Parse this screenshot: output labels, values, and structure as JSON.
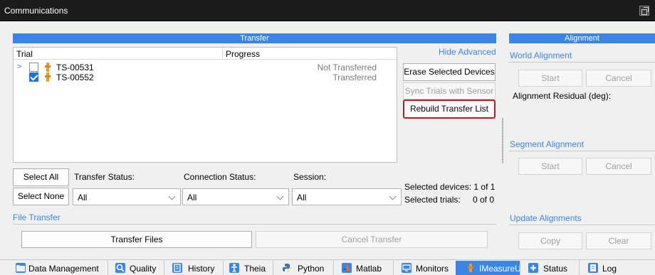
{
  "window": {
    "title": "Communications"
  },
  "transfer": {
    "header": "Transfer",
    "hide_advanced": "Hide Advanced",
    "columns": [
      "Trial",
      "Progress"
    ],
    "trials": [
      {
        "expander": ">",
        "checked": false,
        "name": "TS-00531",
        "status": "Not Transferred"
      },
      {
        "expander": "",
        "checked": true,
        "name": "TS-00552",
        "status": "Transferred"
      }
    ],
    "buttons": {
      "erase": "Erase Selected Devices",
      "sync": "Sync Trials with Sensor",
      "rebuild": "Rebuild Transfer List",
      "select_all": "Select All",
      "select_none": "Select None"
    },
    "filters": {
      "transfer_status_label": "Transfer Status:",
      "transfer_status_value": "All",
      "connection_status_label": "Connection Status:",
      "connection_status_value": "All",
      "session_label": "Session:",
      "session_value": "All"
    },
    "selected_devices": "Selected devices: 1 of 1",
    "selected_trials_label": "Selected trials:",
    "selected_trials_value": "0 of 0"
  },
  "file_transfer": {
    "label": "File Transfer",
    "transfer_files": "Transfer Files",
    "cancel_transfer": "Cancel Transfer"
  },
  "alignment": {
    "header": "Alignment",
    "world": {
      "label": "World Alignment",
      "start": "Start",
      "cancel": "Cancel",
      "residual": "Alignment Residual (deg):"
    },
    "segment": {
      "label": "Segment Alignment",
      "start": "Start",
      "cancel": "Cancel"
    },
    "update": {
      "label": "Update Alignments",
      "copy": "Copy",
      "clear": "Clear"
    }
  },
  "tabs": [
    {
      "label": "Data Management",
      "icon": "folder-icon",
      "color": "#3a86e8"
    },
    {
      "label": "Quality",
      "icon": "search-icon",
      "color": "#3a86e8"
    },
    {
      "label": "History",
      "icon": "history-icon",
      "color": "#3a86e8"
    },
    {
      "label": "Theia",
      "icon": "figure-icon",
      "color": "#3a86e8"
    },
    {
      "label": "Python",
      "icon": "python-icon",
      "color": "#3776ab"
    },
    {
      "label": "Matlab",
      "icon": "matlab-icon",
      "color": "#e16737"
    },
    {
      "label": "Monitors",
      "icon": "monitor-icon",
      "color": "#3a86e8"
    },
    {
      "label": "IMeasureU",
      "icon": "sensor-icon",
      "color": "#f39c12",
      "active": true
    },
    {
      "label": "Status",
      "icon": "plus-icon",
      "color": "#3a86e8"
    },
    {
      "label": "Log",
      "icon": "log-icon",
      "color": "#3a86e8"
    }
  ],
  "colors": {
    "accent": "#3a86e8",
    "focus_border": "#b01e24",
    "title_bar": "#1b1b1b"
  }
}
